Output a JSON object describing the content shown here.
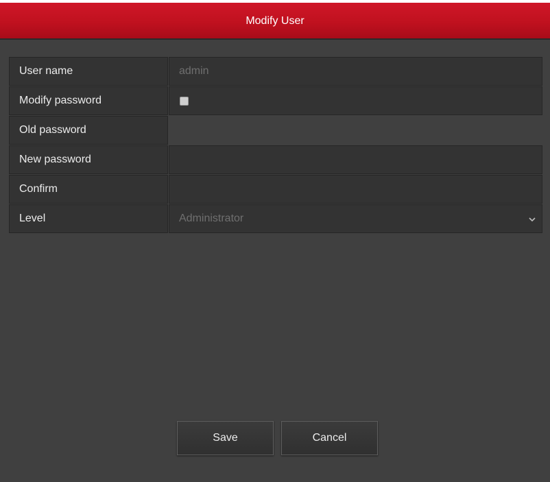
{
  "dialog": {
    "title": "Modify User"
  },
  "form": {
    "user_name": {
      "label": "User name",
      "value": "admin"
    },
    "modify_password": {
      "label": "Modify password",
      "checked": false
    },
    "old_password": {
      "label": "Old password",
      "value": ""
    },
    "new_password": {
      "label": "New password",
      "value": ""
    },
    "confirm": {
      "label": "Confirm",
      "value": ""
    },
    "level": {
      "label": "Level",
      "value": "Administrator"
    }
  },
  "buttons": {
    "save": "Save",
    "cancel": "Cancel"
  },
  "colors": {
    "titlebar": "#c0111f",
    "background": "#404040",
    "cell": "#333333"
  }
}
